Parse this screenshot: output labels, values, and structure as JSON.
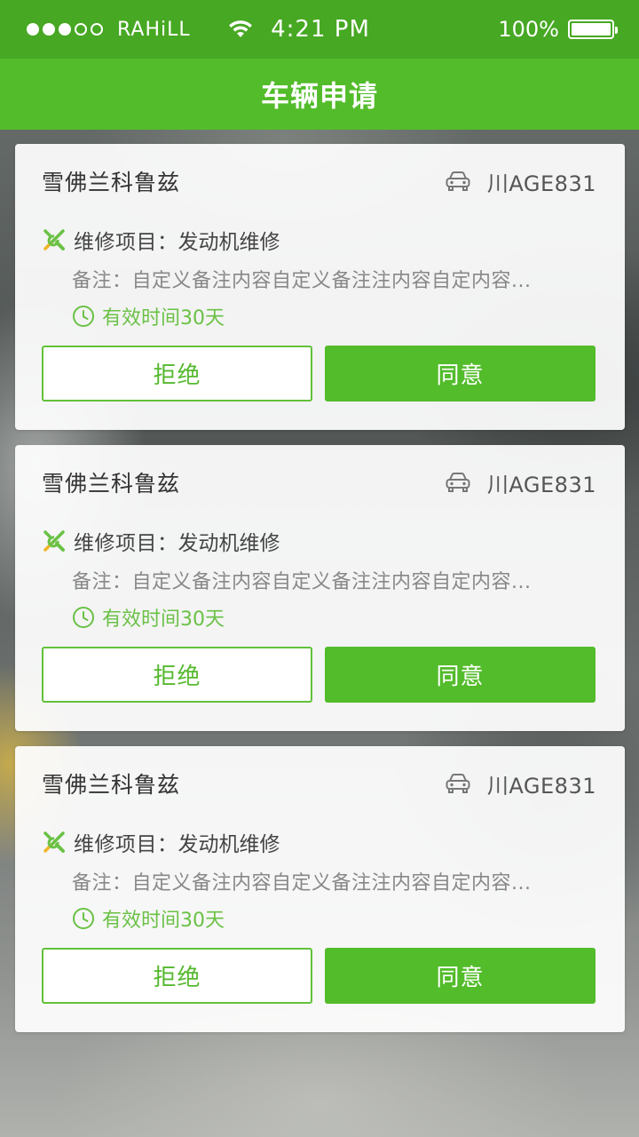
{
  "status_bar": {
    "carrier": "RAHiLL",
    "time": "4:21 PM",
    "battery": "100%"
  },
  "nav": {
    "title": "车辆申请"
  },
  "colors": {
    "primary": "#53bc2b",
    "status_bar": "#47a823",
    "valid_text": "#6ac146"
  },
  "icons": {
    "car": "car-icon",
    "repair": "wrench-screwdriver-icon",
    "time": "clock-icon"
  },
  "cards": [
    {
      "car_name": "雪佛兰科鲁兹",
      "plate": "川AGE831",
      "repair_label": "维修项目：",
      "repair_value": "发动机维修",
      "remark": "备注：自定义备注内容自定义备注注内容自定内容...",
      "valid": "有效时间30天",
      "reject_label": "拒绝",
      "accept_label": "同意"
    },
    {
      "car_name": "雪佛兰科鲁兹",
      "plate": "川AGE831",
      "repair_label": "维修项目：",
      "repair_value": "发动机维修",
      "remark": "备注：自定义备注内容自定义备注注内容自定内容...",
      "valid": "有效时间30天",
      "reject_label": "拒绝",
      "accept_label": "同意"
    },
    {
      "car_name": "雪佛兰科鲁兹",
      "plate": "川AGE831",
      "repair_label": "维修项目：",
      "repair_value": "发动机维修",
      "remark": "备注：自定义备注内容自定义备注注内容自定内容...",
      "valid": "有效时间30天",
      "reject_label": "拒绝",
      "accept_label": "同意"
    }
  ]
}
